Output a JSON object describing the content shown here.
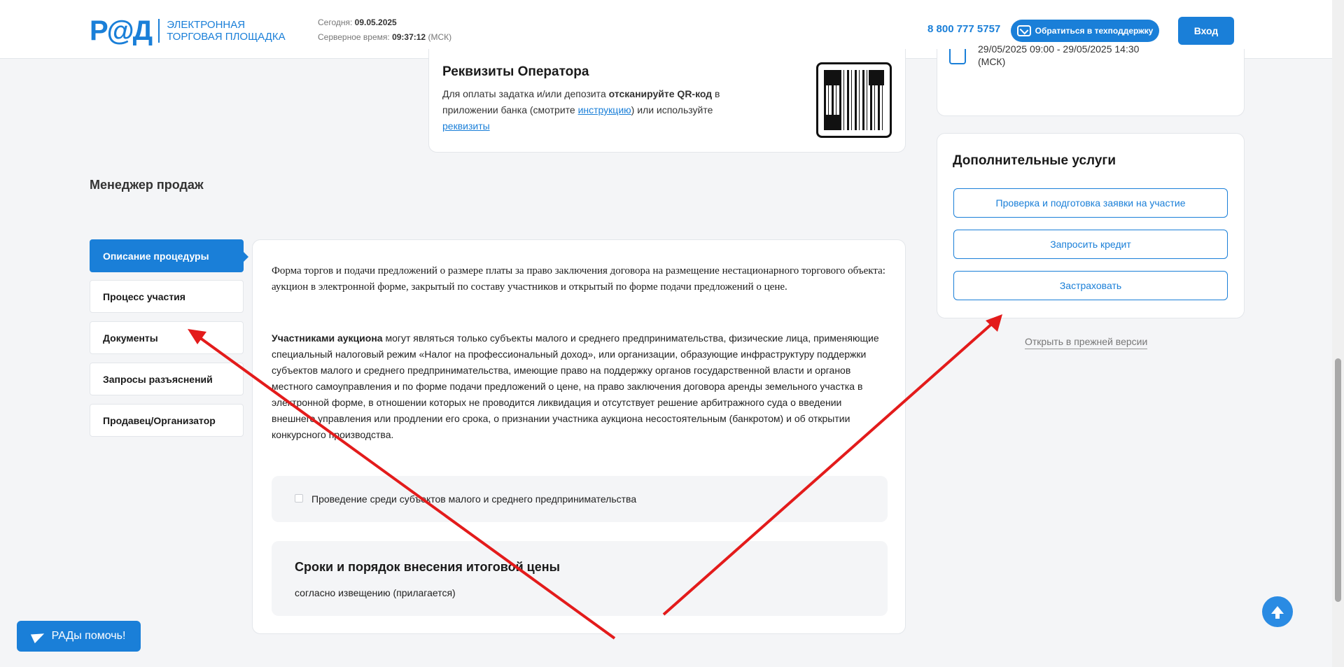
{
  "header": {
    "logo_mark": "Р@Д",
    "logo_line1": "Электронная",
    "logo_line2": "торговая площадка",
    "today_label": "Сегодня:",
    "today_value": "09.05.2025",
    "server_label": "Серверное время:",
    "server_value": "09:37:12",
    "server_tz": "(МСК)",
    "phone": "8 800 777 5757",
    "support_label": "Обратиться в техподдержку",
    "login_label": "Вход"
  },
  "requisites": {
    "title": "Реквизиты Оператора",
    "text_1": "Для оплаты задатка и/или депозита ",
    "text_bold": "отсканируйте QR-код",
    "text_2": " в приложении банка (смотрите ",
    "link_instruction": "инструкцию",
    "text_3": ") или используйте ",
    "link_requisites": "реквизиты"
  },
  "schedule": {
    "dates": "29/05/2025 09:00 - 29/05/2025 14:30",
    "tz": "(МСК)"
  },
  "services": {
    "title": "Дополнительные услуги",
    "buttons": [
      "Проверка и подготовка заявки на участие",
      "Запросить кредит",
      "Застраховать"
    ],
    "old_version": "Открыть в прежней версии"
  },
  "manager": "Менеджер продаж",
  "tabs": [
    "Описание процедуры",
    "Процесс участия",
    "Документы",
    "Запросы разъяснений",
    "Продавец/Организатор"
  ],
  "content": {
    "description_1": "Форма торгов и подачи предложений о размере платы за право заключения договора на размещение нестационарного торгового объекта: аукцион в электронной форме, закрытый по составу участников и открытый по форме подачи предложений о цене.",
    "participants_bold": "Участниками аукциона",
    "participants_text": " могут являться только субъекты малого и среднего предпринимательства, физические лица, применяющие специальный налоговый режим «Налог на профессиональный доход», или организации, образующие инфраструктуру поддержки субъектов малого и среднего предпринимательства, имеющие право на поддержку органов государственной власти и органов местного самоуправления и по форме подачи предложений о цене, на право заключения договора аренды земельного участка в электронной форме, в отношении которых не проводится ликвидация и отсутствует решение арбитражного суда о введении внешнего управления или продлении его срока, о признании участника аукциона несостоятельным (банкротом) и об открытии конкурсного производства.",
    "smsp_label": "Проведение среди субъектов малого и среднего предпринимательства",
    "deadline_title": "Сроки и порядок внесения итоговой цены",
    "deadline_text": "согласно извещению (прилагается)"
  },
  "help_button": "РАДы помочь!",
  "colors": {
    "accent": "#1a7fd8",
    "annotation": "#e31b1b"
  }
}
